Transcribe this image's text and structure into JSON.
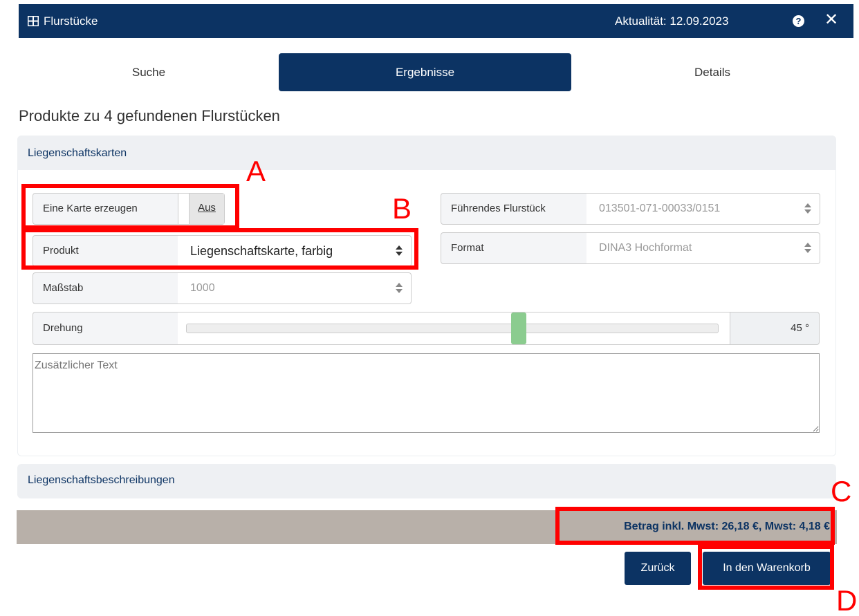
{
  "titlebar": {
    "title": "Flurstücke",
    "aktualitaet": "Aktualität: 12.09.2023",
    "help_glyph": "?",
    "close_glyph": "✕"
  },
  "tabs": [
    {
      "label": "Suche",
      "active": false
    },
    {
      "label": "Ergebnisse",
      "active": true
    },
    {
      "label": "Details",
      "active": false
    }
  ],
  "heading": "Produkte zu 4 gefundenen Flurstücken",
  "liegenschaftskarten": {
    "header": "Liegenschaftskarten",
    "eine_karte_label": "Eine Karte erzeugen",
    "eine_karte_value": "Aus",
    "produkt_label": "Produkt",
    "produkt_value": "Liegenschaftskarte, farbig",
    "massstab_label": "Maßstab",
    "massstab_value": "1000",
    "fuehrendes_label": "Führendes Flurstück",
    "fuehrendes_value": "013501-071-00033/0151",
    "format_label": "Format",
    "format_value": "DINA3 Hochformat",
    "drehung_label": "Drehung",
    "drehung_value": "45",
    "drehung_unit": "°",
    "drehung_fraction": 0.625,
    "zusatz_placeholder": "Zusätzlicher Text"
  },
  "liegenschaftsbeschreibungen": {
    "header": "Liegenschaftsbeschreibungen"
  },
  "total": "Betrag inkl. Mwst: 26,18 €, Mwst: 4,18 €",
  "buttons": {
    "zurueck": "Zurück",
    "warenkorb": "In den Warenkorb"
  },
  "annotations": {
    "a": "A",
    "b": "B",
    "c": "C",
    "d": "D"
  },
  "colors": {
    "primary": "#0c3363",
    "annotation": "#ff0000",
    "slider_thumb": "#8bcc8f"
  }
}
